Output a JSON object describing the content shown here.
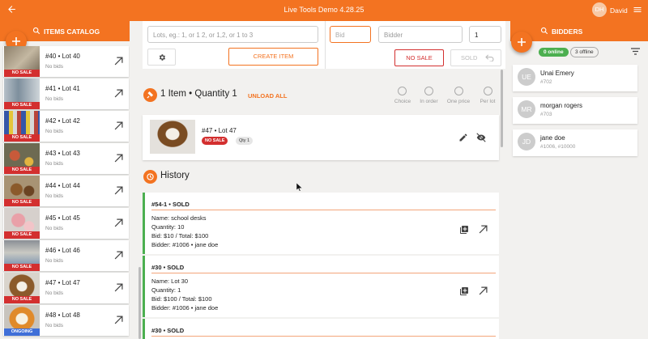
{
  "app": {
    "title": "Live Tools Demo 4.28.25",
    "user_initials": "DH",
    "user_name": "David"
  },
  "colors": {
    "brand": "#f37321",
    "no_sale": "#d32f2f",
    "ongoing": "#3f6fd8",
    "online": "#4caf50"
  },
  "icons": {
    "back": "arrow-left-icon",
    "menu": "hamburger-icon",
    "search": "search-icon",
    "add": "plus-icon",
    "settings": "gear-icon",
    "open": "arrow-up-right-icon",
    "auction": "gavel-icon",
    "history": "clock-icon",
    "edit": "pencil-icon",
    "hide": "eye-off-icon",
    "add_box": "add-box-icon",
    "filter": "filter-icon",
    "undo": "undo-icon"
  },
  "catalog": {
    "title": "ITEMS CATALOG",
    "items": [
      {
        "lot": "#40 • Lot 40",
        "bids": "No bids",
        "status": "NO SALE"
      },
      {
        "lot": "#41 • Lot 41",
        "bids": "No bids",
        "status": "NO SALE"
      },
      {
        "lot": "#42 • Lot 42",
        "bids": "No bids",
        "status": "NO SALE"
      },
      {
        "lot": "#43 • Lot 43",
        "bids": "No bids",
        "status": "NO SALE"
      },
      {
        "lot": "#44 • Lot 44",
        "bids": "No bids",
        "status": "NO SALE"
      },
      {
        "lot": "#45 • Lot 45",
        "bids": "No bids",
        "status": "NO SALE"
      },
      {
        "lot": "#46 • Lot 46",
        "bids": "No bids",
        "status": "NO SALE"
      },
      {
        "lot": "#47 • Lot 47",
        "bids": "No bids",
        "status": "NO SALE"
      },
      {
        "lot": "#48 • Lot 48",
        "bids": "No bids",
        "status": "ONGOING"
      }
    ]
  },
  "controls": {
    "lots_placeholder": "Lots, eg.: 1, or 1 2, or 1,2, or 1 to 3",
    "create_item": "CREATE ITEM",
    "bid_placeholder": "Bid",
    "bidder_placeholder": "Bidder",
    "quantity": "1",
    "no_sale": "NO SALE",
    "sold": "SOLD"
  },
  "current": {
    "summary": "1 Item • Quantity 1",
    "unload_all": "UNLOAD ALL",
    "modes": [
      "Choice",
      "In order",
      "One price",
      "Per lot"
    ],
    "item": {
      "lot": "#47 • Lot 47",
      "status": "NO SALE",
      "qty": "Qty 1"
    }
  },
  "history": {
    "title": "History",
    "entries": [
      {
        "head": "#54-1 • SOLD",
        "lines": [
          "Name: school desks",
          "Quantity: 10",
          "Bid: $10 / Total: $100",
          "Bidder: #1006 • jane doe"
        ]
      },
      {
        "head": "#30 • SOLD",
        "lines": [
          "Name: Lot 30",
          "Quantity: 1",
          "Bid: $100 / Total: $100",
          "Bidder: #1006 • jane doe"
        ]
      },
      {
        "head": "#30 • SOLD",
        "lines": []
      }
    ]
  },
  "bidders": {
    "title": "BIDDERS",
    "online": "0 online",
    "offline": "3 offline",
    "list": [
      {
        "initials": "UE",
        "name": "Unai Emery",
        "number": "#702"
      },
      {
        "initials": "MR",
        "name": "morgan rogers",
        "number": "#703"
      },
      {
        "initials": "JD",
        "name": "jane doe",
        "number": "#1006, #10000"
      }
    ]
  }
}
